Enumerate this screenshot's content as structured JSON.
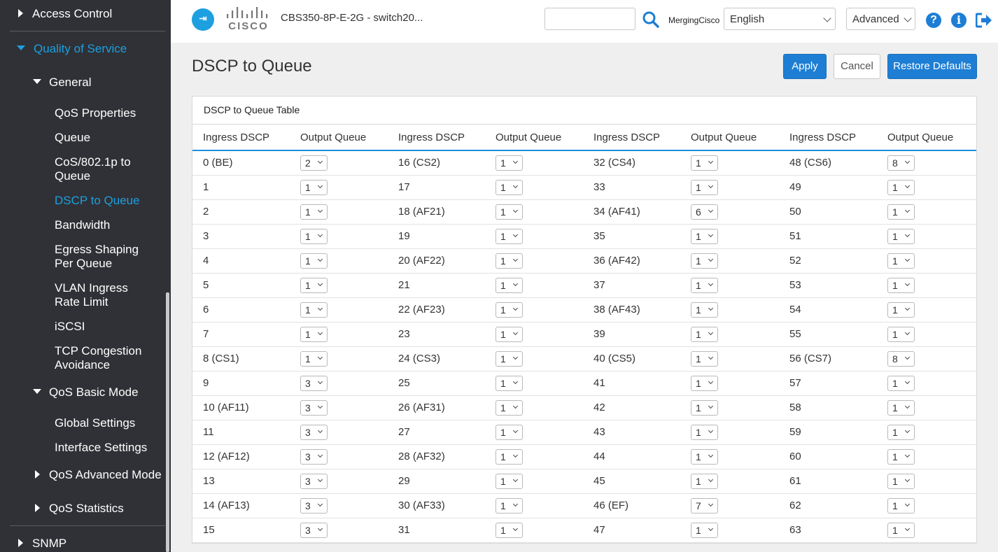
{
  "sidebar": {
    "items": [
      {
        "label": "Access Control",
        "level": 0,
        "state": "collapsed"
      },
      {
        "label": "Quality of Service",
        "level": 0,
        "state": "expanded"
      },
      {
        "label": "General",
        "level": 1,
        "state": "expanded"
      },
      {
        "label": "QoS Properties",
        "level": 2
      },
      {
        "label": "Queue",
        "level": 2
      },
      {
        "label": "CoS/802.1p to Queue",
        "level": 2
      },
      {
        "label": "DSCP to Queue",
        "level": 2,
        "active": true
      },
      {
        "label": "Bandwidth",
        "level": 2
      },
      {
        "label": "Egress Shaping Per Queue",
        "level": 2
      },
      {
        "label": "VLAN Ingress Rate Limit",
        "level": 2
      },
      {
        "label": "iSCSI",
        "level": 2
      },
      {
        "label": "TCP Congestion Avoidance",
        "level": 2
      },
      {
        "label": "QoS Basic Mode",
        "level": 1,
        "state": "expanded"
      },
      {
        "label": "Global Settings",
        "level": 2
      },
      {
        "label": "Interface Settings",
        "level": 2
      },
      {
        "label": "QoS Advanced Mode",
        "level": 1,
        "state": "collapsed"
      },
      {
        "label": "QoS Statistics",
        "level": 1,
        "state": "collapsed"
      },
      {
        "label": "SNMP",
        "level": 0,
        "state": "collapsed"
      }
    ]
  },
  "header": {
    "logo_text": "CISCO",
    "device_title": "CBS350-8P-E-2G - switch20...",
    "search": {
      "value": "",
      "placeholder": ""
    },
    "user_name": "MergingCisco",
    "language": "English",
    "mode": "Advanced",
    "help_glyph": "?",
    "info_glyph": "i",
    "icons": [
      "app-menu-icon",
      "cisco-logo",
      "search-icon",
      "help-icon",
      "info-icon",
      "logout-icon"
    ]
  },
  "page": {
    "title": "DSCP to Queue",
    "buttons": {
      "apply": "Apply",
      "cancel": "Cancel",
      "restore": "Restore Defaults"
    }
  },
  "table": {
    "title": "DSCP to Queue Table",
    "headers": [
      "Ingress DSCP",
      "Output Queue",
      "Ingress DSCP",
      "Output Queue",
      "Ingress DSCP",
      "Output Queue",
      "Ingress DSCP",
      "Output Queue"
    ],
    "rows": [
      [
        "0 (BE)",
        "2",
        "16 (CS2)",
        "1",
        "32 (CS4)",
        "1",
        "48 (CS6)",
        "8"
      ],
      [
        "1",
        "1",
        "17",
        "1",
        "33",
        "1",
        "49",
        "1"
      ],
      [
        "2",
        "1",
        "18 (AF21)",
        "1",
        "34 (AF41)",
        "6",
        "50",
        "1"
      ],
      [
        "3",
        "1",
        "19",
        "1",
        "35",
        "1",
        "51",
        "1"
      ],
      [
        "4",
        "1",
        "20 (AF22)",
        "1",
        "36 (AF42)",
        "1",
        "52",
        "1"
      ],
      [
        "5",
        "1",
        "21",
        "1",
        "37",
        "1",
        "53",
        "1"
      ],
      [
        "6",
        "1",
        "22 (AF23)",
        "1",
        "38 (AF43)",
        "1",
        "54",
        "1"
      ],
      [
        "7",
        "1",
        "23",
        "1",
        "39",
        "1",
        "55",
        "1"
      ],
      [
        "8 (CS1)",
        "1",
        "24 (CS3)",
        "1",
        "40 (CS5)",
        "1",
        "56 (CS7)",
        "8"
      ],
      [
        "9",
        "3",
        "25",
        "1",
        "41",
        "1",
        "57",
        "1"
      ],
      [
        "10 (AF11)",
        "3",
        "26 (AF31)",
        "1",
        "42",
        "1",
        "58",
        "1"
      ],
      [
        "11",
        "3",
        "27",
        "1",
        "43",
        "1",
        "59",
        "1"
      ],
      [
        "12 (AF12)",
        "3",
        "28 (AF32)",
        "1",
        "44",
        "1",
        "60",
        "1"
      ],
      [
        "13",
        "3",
        "29",
        "1",
        "45",
        "1",
        "61",
        "1"
      ],
      [
        "14 (AF13)",
        "3",
        "30 (AF33)",
        "1",
        "46 (EF)",
        "7",
        "62",
        "1"
      ],
      [
        "15",
        "3",
        "31",
        "1",
        "47",
        "1",
        "63",
        "1"
      ]
    ]
  },
  "colors": {
    "accent": "#1d9fe0",
    "button_primary": "#1d7ed4",
    "sidebar_bg": "#2f3136"
  }
}
